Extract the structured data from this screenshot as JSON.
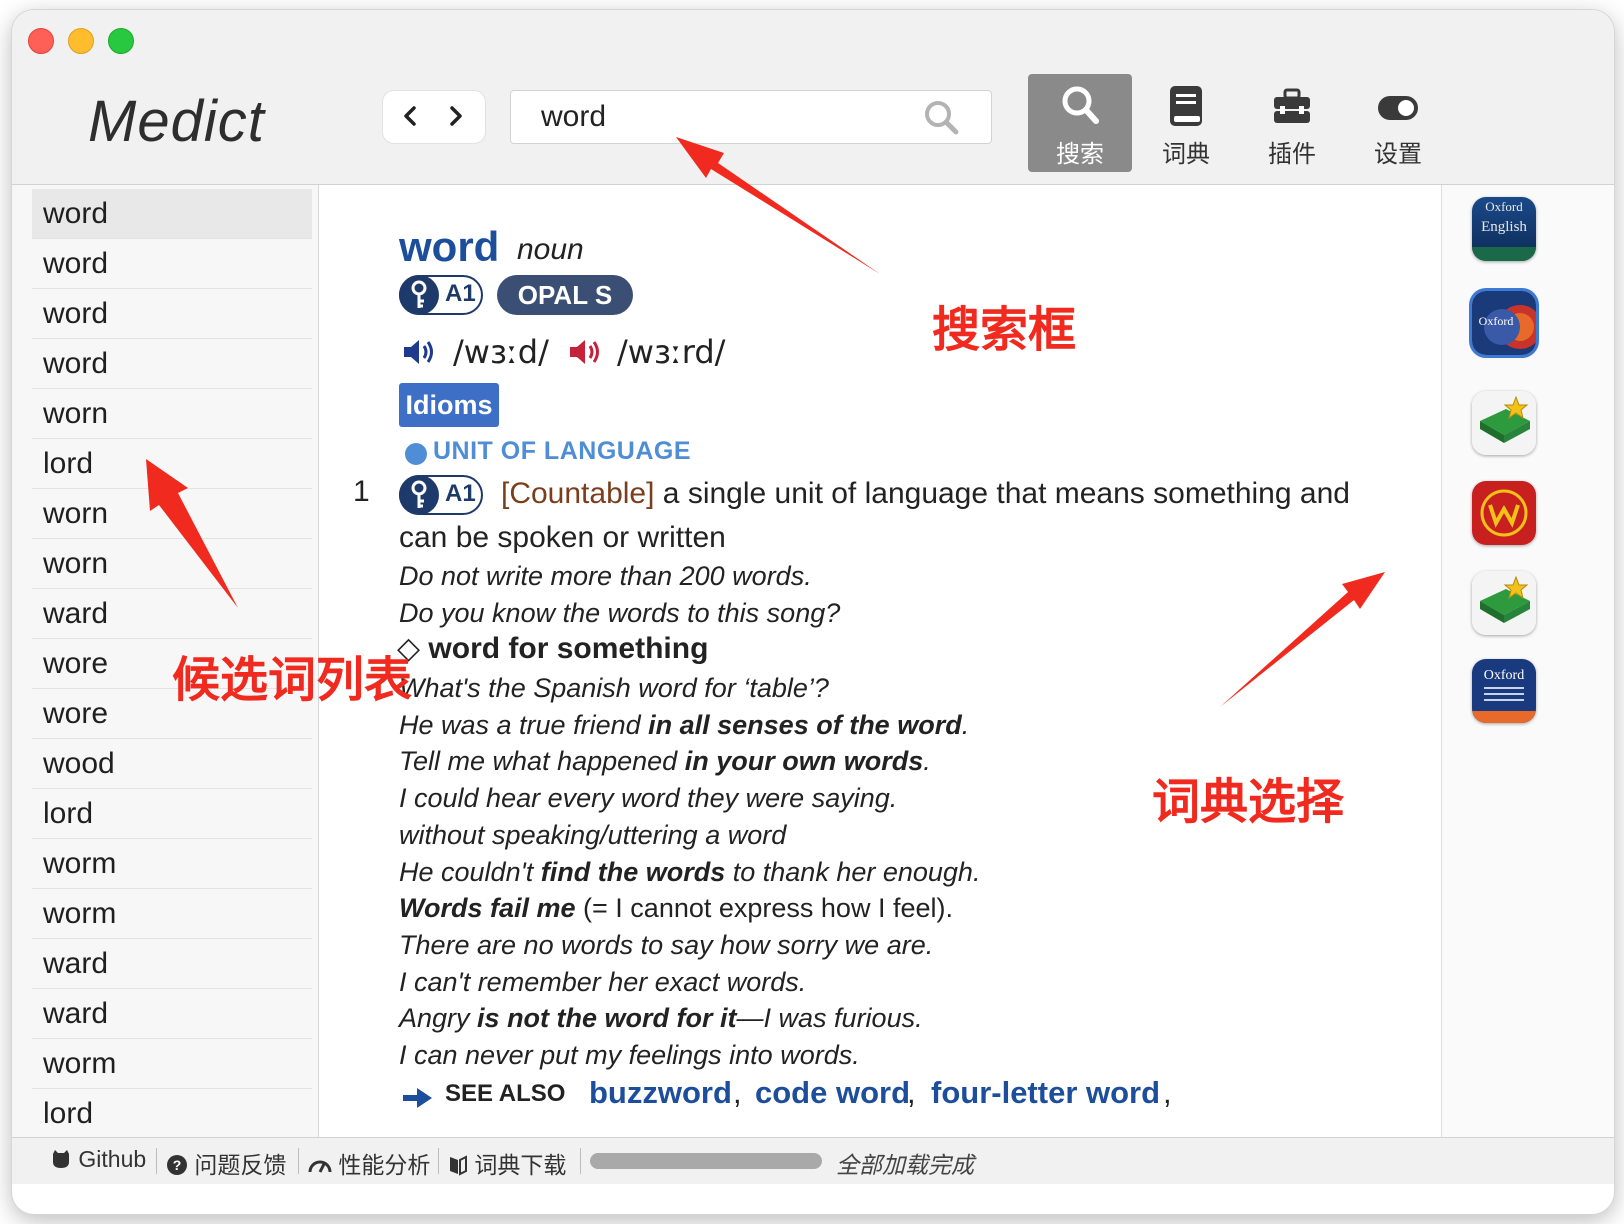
{
  "app": {
    "title": "Medict"
  },
  "nav": {
    "back": "‹",
    "forward": "›"
  },
  "search": {
    "value": "word",
    "placeholder": ""
  },
  "tools": [
    {
      "label": "搜索",
      "icon": "search-icon",
      "active": true
    },
    {
      "label": "词典",
      "icon": "book-icon",
      "active": false
    },
    {
      "label": "插件",
      "icon": "toolbox-icon",
      "active": false
    },
    {
      "label": "设置",
      "icon": "toggle-icon",
      "active": false
    }
  ],
  "candidates": [
    "word",
    "word",
    "word",
    "word",
    "worn",
    "lord",
    "worn",
    "worn",
    "ward",
    "wore",
    "wore",
    "wood",
    "lord",
    "worm",
    "worm",
    "ward",
    "ward",
    "worm",
    "lord"
  ],
  "entry": {
    "headword": "word",
    "pos": "noun",
    "level": "A1",
    "opal": "OPAL S",
    "phonetic_br": "/wɜːd/",
    "phonetic_us": "/wɜːrd/",
    "idioms_label": "Idioms",
    "topic": "UNIT OF LANGUAGE",
    "sense_number": "1",
    "sense_grammar": "[Countable]",
    "sense_def_1": "a single unit of language that means something and",
    "sense_def_2": "can be spoken or written",
    "examples": [
      "Do not write more than 200 words.",
      "Do you know the words to this song?"
    ],
    "idiom": "word for something",
    "idiom_marker": "◇",
    "idiom_examples": {
      "e1": "What's the Spanish word for ‘table’?",
      "e2a": "He was a true friend ",
      "e2b": "in all senses of the word",
      "e2c": ".",
      "e3a": "Tell me what happened ",
      "e3b": "in your own words",
      "e3c": ".",
      "e4": "I could hear every word they were saying.",
      "e5": "without speaking/uttering a word",
      "e6a": "He couldn't ",
      "e6b": "find the words",
      "e6c": " to thank her enough.",
      "e7a": "Words fail me",
      "e7b": " (= I cannot express how I feel).",
      "e8": "There are no words to say how sorry we are.",
      "e9": "I can't remember her exact words.",
      "e10a": "Angry ",
      "e10b": "is not the word for it",
      "e10c": "—I was furious.",
      "e11": "I can never put my feelings into words."
    },
    "see_also_label": "SEE ALSO",
    "see_also": [
      "buzzword",
      "code word",
      "four-letter word"
    ],
    "separator": ","
  },
  "dictionaries": [
    {
      "name": "Oxford Dictionary of English",
      "icon": "oxford-english-icon",
      "label_1": "Oxford",
      "label_2": "English",
      "selected": false
    },
    {
      "name": "Oxford Advanced Learner's Dictionary",
      "icon": "oald-icon",
      "label_1": "Oxford",
      "selected": true
    },
    {
      "name": "Dictionary",
      "icon": "green-book-star-icon",
      "selected": false
    },
    {
      "name": "Webster",
      "icon": "webster-seal-icon",
      "selected": false
    },
    {
      "name": "Dictionary",
      "icon": "green-book-star-icon",
      "selected": false
    },
    {
      "name": "Oxford Advanced Learner's Dictionary",
      "icon": "oald-10th-icon",
      "label_1": "Oxford",
      "selected": false
    }
  ],
  "status": {
    "github": "Github",
    "feedback": "问题反馈",
    "perf": "性能分析",
    "download": "词典下载",
    "progress": 1.0,
    "message": "全部加载完成"
  },
  "annotations": {
    "search_box": "搜索框",
    "candidate_list": "候选词列表",
    "dict_select": "词典选择"
  },
  "colors": {
    "accent_blue": "#1d4e9c",
    "annotation_red": "#f02a1e",
    "idioms_bg": "#3d6fc6"
  }
}
